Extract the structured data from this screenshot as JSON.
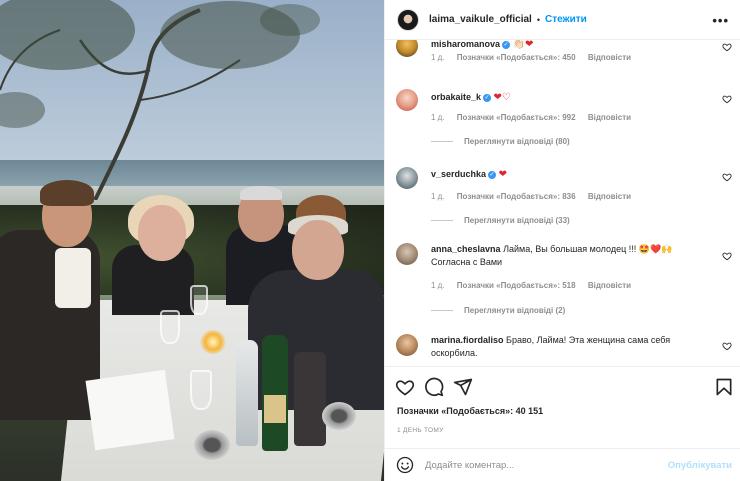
{
  "header": {
    "username": "laima_vaikule_official",
    "separator": "•",
    "follow_label": "Стежити",
    "more_label": "•••"
  },
  "comments": [
    {
      "username": "misharomanova",
      "verified": true,
      "text": "",
      "emoji": "👏🏻❤",
      "meta_time": "1 д.",
      "meta_likes": "Позначки «Подобається»: 450",
      "meta_reply": "Відповісти",
      "view_replies": ""
    },
    {
      "username": "orbakaite_k",
      "verified": true,
      "text": "",
      "emoji": "❤♡",
      "meta_time": "1 д.",
      "meta_likes": "Позначки «Подобається»: 992",
      "meta_reply": "Відповісти",
      "view_replies": "Переглянути відповіді (80)"
    },
    {
      "username": "v_serduchka",
      "verified": true,
      "text": "",
      "emoji": "❤",
      "meta_time": "1 д.",
      "meta_likes": "Позначки «Подобається»: 836",
      "meta_reply": "Відповісти",
      "view_replies": "Переглянути відповіді (33)"
    },
    {
      "username": "anna_cheslavna",
      "verified": false,
      "text": "Лайма, Вы большая молодец !!! 🤩❤️🙌 Согласна с Вами",
      "emoji": "",
      "meta_time": "1 д.",
      "meta_likes": "Позначки «Подобається»: 518",
      "meta_reply": "Відповісти",
      "view_replies": "Переглянути відповіді (2)"
    },
    {
      "username": "marina.fiordaliso",
      "verified": false,
      "text": "Браво, Лайма! Эта женщина сама себя оскорбила.",
      "emoji": "",
      "meta_time": "",
      "meta_likes": "",
      "meta_reply": "",
      "view_replies": ""
    }
  ],
  "actions": {
    "like_icon": "heart-outline-icon",
    "comment_icon": "comment-bubble-icon",
    "share_icon": "paper-plane-icon",
    "save_icon": "bookmark-icon"
  },
  "likes_text": "Позначки «Подобається»: 40 151",
  "time_text": "1 ДЕНЬ ТОМУ",
  "add_comment": {
    "placeholder": "Додайте коментар...",
    "publish_label": "Опублікувати"
  },
  "colors": {
    "link_blue": "#0095f6",
    "publish_disabled": "#b2dffc",
    "secondary_text": "#8e8e8e",
    "heart_red": "#e02432",
    "verified_blue": "#3897f0"
  }
}
